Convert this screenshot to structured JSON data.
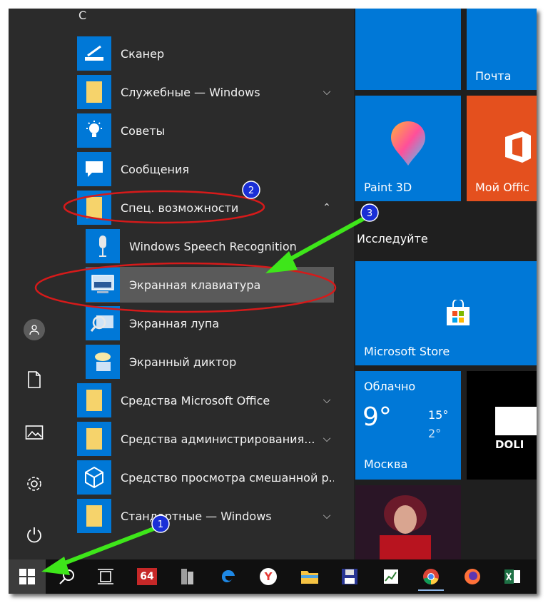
{
  "section_letter": "C",
  "apps": [
    {
      "label": "Сканер",
      "icon": "scanner-icon"
    },
    {
      "label": "Служебные — Windows",
      "icon": "folder-icon"
    },
    {
      "label": "Советы",
      "icon": "lightbulb-icon"
    },
    {
      "label": "Сообщения",
      "icon": "message-icon"
    },
    {
      "label": "Спец. возможности",
      "icon": "folder-icon"
    },
    {
      "label": "Windows Speech Recognition",
      "icon": "microphone-icon"
    },
    {
      "label": "Экранная клавиатура",
      "icon": "keyboard-icon"
    },
    {
      "label": "Экранная лупа",
      "icon": "magnifier-icon"
    },
    {
      "label": "Экранный диктор",
      "icon": "narrator-icon"
    },
    {
      "label": "Средства Microsoft Office",
      "icon": "folder-icon"
    },
    {
      "label": "Средства администрирования...",
      "icon": "folder-icon"
    },
    {
      "label": "Средство просмотра смешанной р...",
      "icon": "cube-icon"
    },
    {
      "label": "Стандартные — Windows",
      "icon": "folder-icon"
    }
  ],
  "tiles": {
    "mail": "Почта",
    "paint3d": "Paint 3D",
    "office": "Мой Offic",
    "group_title": "Исследуйте",
    "store": "Microsoft Store",
    "weather": {
      "condition": "Облачно",
      "temp": "9°",
      "high": "15°",
      "low": "2°",
      "city": "Москва"
    },
    "dolby": "DOLI"
  },
  "taskbar": {
    "app64_label": "64"
  },
  "annotations": {
    "marker1": "1",
    "marker2": "2",
    "marker3": "3"
  },
  "colors": {
    "accent": "#0078d7",
    "highlight": "#5a5a5a",
    "annotation_red": "#d61a1a",
    "annotation_green": "#3ee61a",
    "marker_blue": "#1a2fd6"
  }
}
